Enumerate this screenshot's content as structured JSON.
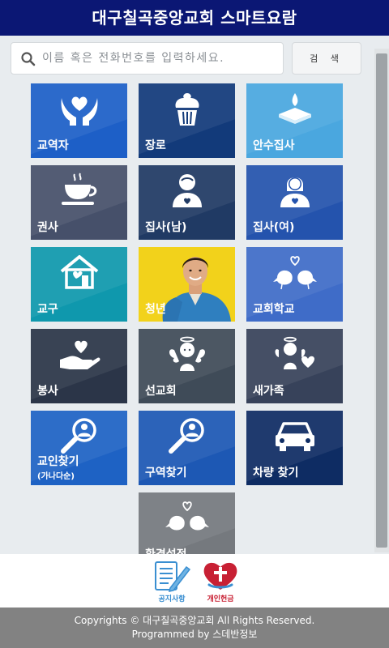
{
  "header": {
    "title": "대구칠곡중앙교회 스마트요람"
  },
  "search": {
    "placeholder": "이름 혹은 전화번호를 입력하세요.",
    "button_label": "검 색"
  },
  "tiles": [
    {
      "label": "교역자",
      "icon": "hands-heart-icon",
      "color": "#1d5fc7"
    },
    {
      "label": "장로",
      "icon": "cupcake-icon",
      "color": "#123a7a"
    },
    {
      "label": "안수집사",
      "icon": "candle-icon",
      "color": "#4aa7df"
    },
    {
      "label": "권사",
      "icon": "teacup-icon",
      "color": "#46506a"
    },
    {
      "label": "집사(남)",
      "icon": "person-male-icon",
      "color": "#203a64"
    },
    {
      "label": "집사(여)",
      "icon": "person-female-icon",
      "color": "#2453ad"
    },
    {
      "label": "교구",
      "icon": "house-heart-icon",
      "color": "#0f98ad"
    },
    {
      "label": "청년",
      "icon": "young-man-photo",
      "color": "#f2d21b"
    },
    {
      "label": "교회학교",
      "icon": "birds-heart-icon",
      "color": "#3f6cc8"
    },
    {
      "label": "봉사",
      "icon": "hand-heart-icon",
      "color": "#2b3548"
    },
    {
      "label": "선교회",
      "icon": "angel-icon",
      "color": "#3f4b58"
    },
    {
      "label": "새가족",
      "icon": "angel-heart-icon",
      "color": "#37425a"
    },
    {
      "label": "교인찾기",
      "sub": "(가나다순)",
      "icon": "magnifier-person-icon",
      "color": "#1e62c4"
    },
    {
      "label": "구역찾기",
      "icon": "magnifier-person-icon",
      "color": "#1d58b4"
    },
    {
      "label": "차량 찾기",
      "icon": "car-icon",
      "color": "#0e2c63"
    },
    {
      "label": "환경설정",
      "icon": "birds-heart-icon",
      "color": "#75797e"
    }
  ],
  "footer_icons": [
    {
      "label": "공지사항",
      "icon": "notice-clipboard-icon",
      "color": "#3a8fd1"
    },
    {
      "label": "개인헌금",
      "icon": "cross-heart-icon",
      "color": "#c82034"
    }
  ],
  "copyright": {
    "line1": "Copyrights © 대구칠곡중앙교회 All Rights Reserved.",
    "line2": "Programmed by 스데반정보"
  }
}
